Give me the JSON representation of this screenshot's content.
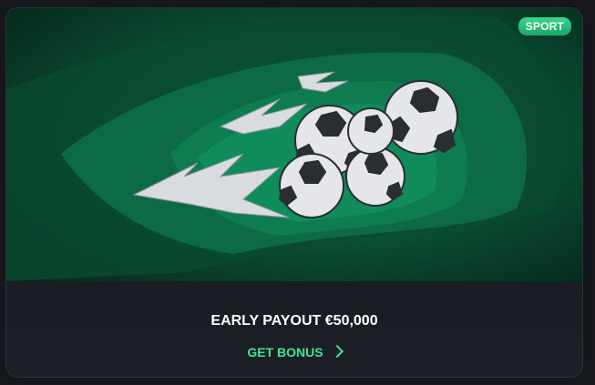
{
  "card": {
    "badge": "SPORT",
    "title": "EARLY PAYOUT €50,000",
    "cta_label": "GET BONUS",
    "cta_icon": "chevron-right-icon",
    "banner_icon": "flaming-soccer-balls-illustration"
  },
  "colors": {
    "accent": "#3ee68f",
    "badge_bg": "#2bc27a",
    "card_bg": "#1b1e25",
    "banner_green": "#0b5c3c"
  }
}
